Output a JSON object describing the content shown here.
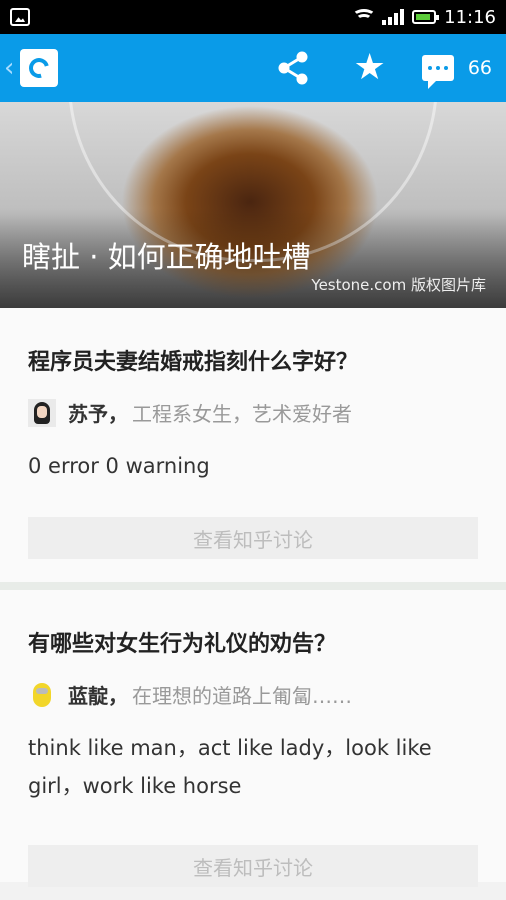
{
  "status_bar": {
    "time": "11:16"
  },
  "app_bar": {
    "comment_count": "66"
  },
  "hero": {
    "title": "瞎扯 · 如何正确地吐槽",
    "credit": "Yestone.com 版权图片库"
  },
  "questions": [
    {
      "title": "程序员夫妻结婚戒指刻什么字好？",
      "author_name": "苏予，",
      "author_desc": "工程系女生，艺术爱好者",
      "answer": "0 error 0 warning",
      "button_label": "查看知乎讨论"
    },
    {
      "title": "有哪些对女生行为礼仪的劝告？",
      "author_name": "蓝靛，",
      "author_desc": "在理想的道路上匍匐……",
      "answer": "think like man，act like lady，look like girl，work like horse",
      "button_label": "查看知乎讨论"
    }
  ]
}
